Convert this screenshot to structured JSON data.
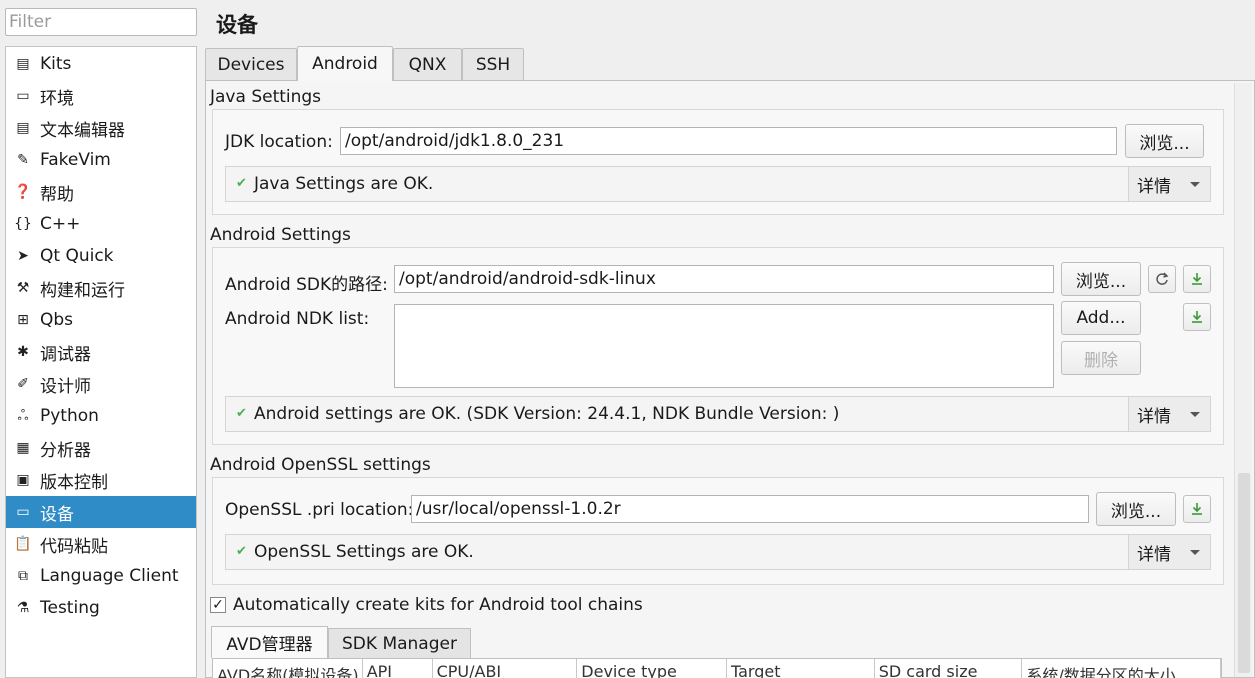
{
  "filter": {
    "placeholder": "Filter"
  },
  "nav": {
    "items": [
      {
        "label": "Kits",
        "icon": "kits-icon",
        "glyph": "▤"
      },
      {
        "label": "环境",
        "icon": "monitor-icon",
        "glyph": "▭"
      },
      {
        "label": "文本编辑器",
        "icon": "text-editor-icon",
        "glyph": "▤"
      },
      {
        "label": "FakeVim",
        "icon": "fakevim-icon",
        "glyph": "✎"
      },
      {
        "label": "帮助",
        "icon": "help-icon",
        "glyph": "❓"
      },
      {
        "label": "C++",
        "icon": "braces-icon",
        "glyph": "{}"
      },
      {
        "label": "Qt Quick",
        "icon": "qtquick-icon",
        "glyph": "➤"
      },
      {
        "label": "构建和运行",
        "icon": "hammer-icon",
        "glyph": "⚒"
      },
      {
        "label": "Qbs",
        "icon": "qbs-icon",
        "glyph": "⊞"
      },
      {
        "label": "调试器",
        "icon": "bug-icon",
        "glyph": "✱"
      },
      {
        "label": "设计师",
        "icon": "pencil-icon",
        "glyph": "✐"
      },
      {
        "label": "Python",
        "icon": "python-icon",
        "glyph": "ஃ"
      },
      {
        "label": "分析器",
        "icon": "analyzer-icon",
        "glyph": "▦"
      },
      {
        "label": "版本控制",
        "icon": "version-control-icon",
        "glyph": "▣"
      },
      {
        "label": "设备",
        "icon": "devices-icon",
        "glyph": "▭"
      },
      {
        "label": "代码粘贴",
        "icon": "paste-icon",
        "glyph": "📋"
      },
      {
        "label": "Language Client",
        "icon": "language-client-icon",
        "glyph": "⧉"
      },
      {
        "label": "Testing",
        "icon": "testing-icon",
        "glyph": "⚗"
      }
    ],
    "selected_index": 14
  },
  "header": {
    "title": "设备"
  },
  "tabs": [
    "Devices",
    "Android",
    "QNX",
    "SSH"
  ],
  "active_tab": "Android",
  "java": {
    "section_title": "Java Settings",
    "jdk_label": "JDK location:",
    "jdk_value": "/opt/android/jdk1.8.0_231",
    "browse_label": "浏览...",
    "status": "Java Settings are OK.",
    "details_label": "详情"
  },
  "android": {
    "section_title": "Android Settings",
    "sdk_label": "Android SDK的路径:",
    "sdk_value": "/opt/android/android-sdk-linux",
    "browse_label": "浏览...",
    "ndk_label": "Android NDK list:",
    "add_label": "Add...",
    "remove_label": "删除",
    "status": "Android settings are OK. (SDK Version: 24.4.1, NDK Bundle Version: )",
    "details_label": "详情"
  },
  "openssl": {
    "section_title": "Android OpenSSL settings",
    "location_label": "OpenSSL .pri location:",
    "location_value": "/usr/local/openssl-1.0.2r",
    "browse_label": "浏览...",
    "status": "OpenSSL Settings are OK.",
    "details_label": "详情"
  },
  "auto_kits": {
    "label": "Automatically create kits for Android tool chains",
    "checked": true
  },
  "subtabs": [
    "AVD管理器",
    "SDK Manager"
  ],
  "avd_columns": [
    "AVD名称(模拟设备)",
    "API",
    "CPU/ABI",
    "Device type",
    "Target",
    "SD card size",
    "系统/数据分区的大小"
  ],
  "colors": {
    "selection": "#308cc6",
    "ok_check": "#4caf50"
  }
}
